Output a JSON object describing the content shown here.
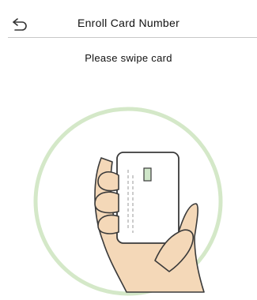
{
  "header": {
    "title": "Enroll Card Number",
    "back_icon": "back-arrow-icon"
  },
  "main": {
    "prompt": "Please swipe card",
    "illustration_icon": "hand-holding-card-icon"
  },
  "colors": {
    "ring": "#d4e8c8",
    "skin": "#f4d8b8",
    "card": "#ffffff",
    "outline": "#3a3a3a",
    "chip": "#cfe6c9"
  }
}
